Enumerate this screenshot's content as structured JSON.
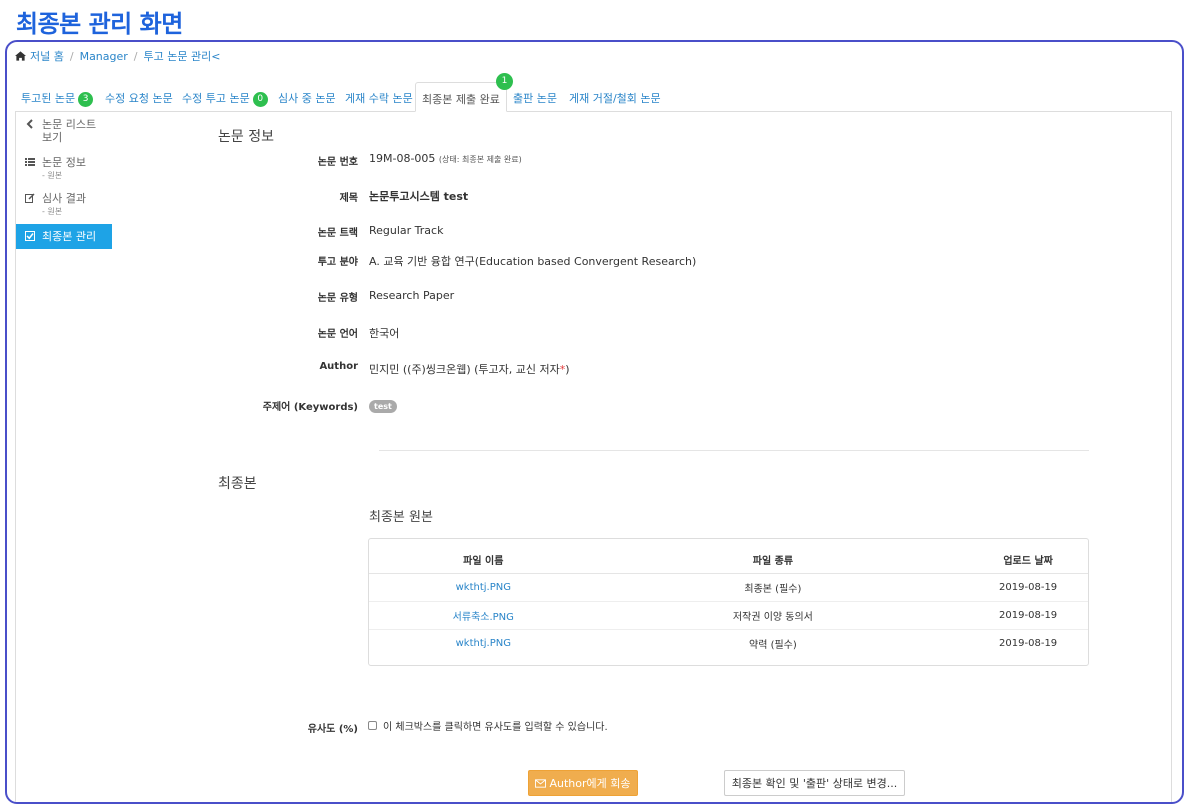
{
  "page_heading": "최종본 관리 화면",
  "breadcrumb": {
    "home": "저널 홈",
    "manager": "Manager",
    "current": "투고 논문 관리<"
  },
  "tabs": [
    {
      "label": "투고된 논문",
      "badge": "3"
    },
    {
      "label": "수정 요청 논문"
    },
    {
      "label": "수정 투고 논문",
      "badge": "0"
    },
    {
      "label": "심사 중 논문"
    },
    {
      "label": "게재 수락 논문"
    },
    {
      "label": "최종본 제출 완료",
      "badge_top": "1",
      "active": true
    },
    {
      "label": "출판 논문"
    },
    {
      "label": "게재 거절/철회 논문"
    }
  ],
  "sidebar": {
    "items": [
      {
        "label": "논문 리스트",
        "label2": "보기",
        "icon": "chevron-left-icon"
      },
      {
        "label": "논문 정보",
        "sub": "- 원본",
        "icon": "list-icon"
      },
      {
        "label": "심사 결과",
        "sub": "- 원본",
        "icon": "edit-icon"
      },
      {
        "label": "최종본 관리",
        "icon": "check-square-icon",
        "active": true
      }
    ]
  },
  "paper_info": {
    "section_title": "논문 정보",
    "fields": {
      "number": {
        "label": "논문 번호",
        "value": "19M-08-005",
        "status": "(상태: 최종본 제출 완료)"
      },
      "title": {
        "label": "제목",
        "value": "논문투고시스템 test"
      },
      "track": {
        "label": "논문 트랙",
        "value": "Regular Track"
      },
      "field": {
        "label": "투고 분야",
        "value": "A. 교육 기반 융합 연구(Education based Convergent Research)"
      },
      "type": {
        "label": "논문 유형",
        "value": "Research Paper"
      },
      "language": {
        "label": "논문 언어",
        "value": "한국어"
      },
      "author": {
        "label": "Author",
        "value": "민지민 ((주)씽크온웹) (투고자, 교신 저자",
        "star": "*",
        "close": ")"
      },
      "keywords": {
        "label": "주제어 (Keywords)",
        "value": "test"
      }
    }
  },
  "final": {
    "section_title": "최종본",
    "subtitle": "최종본 원본",
    "table": {
      "headers": [
        "파일 이름",
        "파일 종류",
        "업로드 날짜"
      ],
      "rows": [
        [
          "wkthtj.PNG",
          "최종본 (필수)",
          "2019-08-19"
        ],
        [
          "서류축소.PNG",
          "저작권 이양 동의서",
          "2019-08-19"
        ],
        [
          "wkthtj.PNG",
          "약력 (필수)",
          "2019-08-19"
        ]
      ]
    }
  },
  "similarity": {
    "label": "유사도 (%)",
    "checkbox_text": "이 체크박스를 클릭하면 유사도를 입력할 수 있습니다."
  },
  "buttons": {
    "return_label": "Author에게 회송",
    "confirm_label": "최종본 확인 및 '출판' 상태로 변경..."
  },
  "colors": {
    "heading": "#1e63dc",
    "frame": "#4a4fc9",
    "link": "#2a85c9",
    "badge": "#2ebf4f",
    "active_nav": "#1ea3e6",
    "warn_button": "#f0ad4e"
  }
}
